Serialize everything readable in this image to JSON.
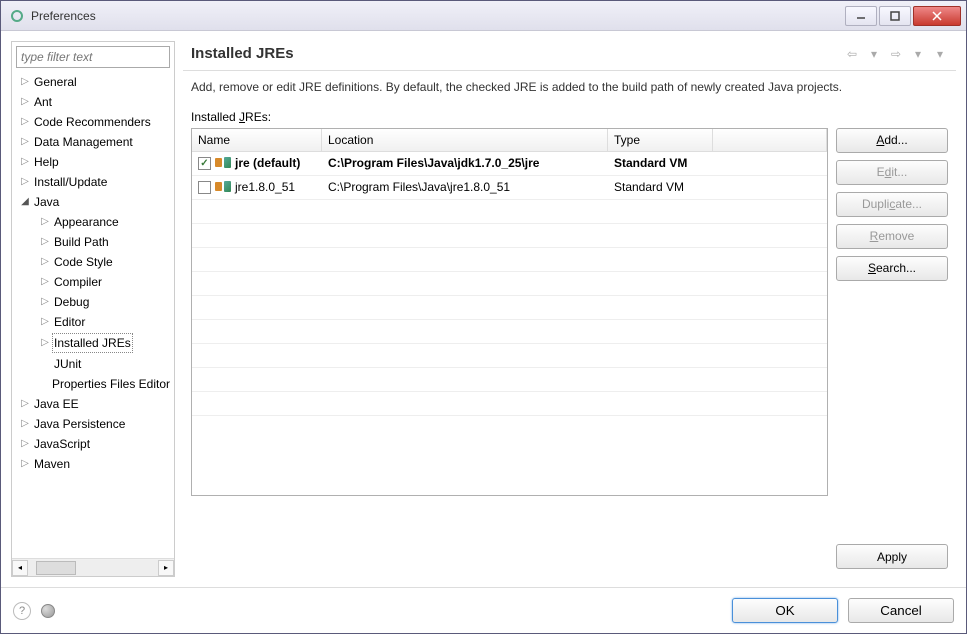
{
  "window": {
    "title": "Preferences"
  },
  "filter_placeholder": "type filter text",
  "tree": {
    "items": [
      {
        "label": "General",
        "level": 1,
        "expandable": true,
        "expanded": false
      },
      {
        "label": "Ant",
        "level": 1,
        "expandable": true,
        "expanded": false
      },
      {
        "label": "Code Recommenders",
        "level": 1,
        "expandable": true,
        "expanded": false
      },
      {
        "label": "Data Management",
        "level": 1,
        "expandable": true,
        "expanded": false
      },
      {
        "label": "Help",
        "level": 1,
        "expandable": true,
        "expanded": false
      },
      {
        "label": "Install/Update",
        "level": 1,
        "expandable": true,
        "expanded": false
      },
      {
        "label": "Java",
        "level": 1,
        "expandable": true,
        "expanded": true
      },
      {
        "label": "Appearance",
        "level": 2,
        "expandable": true,
        "expanded": false
      },
      {
        "label": "Build Path",
        "level": 2,
        "expandable": true,
        "expanded": false
      },
      {
        "label": "Code Style",
        "level": 2,
        "expandable": true,
        "expanded": false
      },
      {
        "label": "Compiler",
        "level": 2,
        "expandable": true,
        "expanded": false
      },
      {
        "label": "Debug",
        "level": 2,
        "expandable": true,
        "expanded": false
      },
      {
        "label": "Editor",
        "level": 2,
        "expandable": true,
        "expanded": false
      },
      {
        "label": "Installed JREs",
        "level": 2,
        "expandable": true,
        "expanded": false,
        "selected": true
      },
      {
        "label": "JUnit",
        "level": 2,
        "expandable": false,
        "expanded": false
      },
      {
        "label": "Properties Files Editor",
        "level": 2,
        "expandable": false,
        "expanded": false
      },
      {
        "label": "Java EE",
        "level": 1,
        "expandable": true,
        "expanded": false
      },
      {
        "label": "Java Persistence",
        "level": 1,
        "expandable": true,
        "expanded": false
      },
      {
        "label": "JavaScript",
        "level": 1,
        "expandable": true,
        "expanded": false
      },
      {
        "label": "Maven",
        "level": 1,
        "expandable": true,
        "expanded": false
      }
    ]
  },
  "main": {
    "title": "Installed JREs",
    "description": "Add, remove or edit JRE definitions. By default, the checked JRE is added to the build path of newly created Java projects.",
    "table_label_pre": "Installed ",
    "table_label_u": "J",
    "table_label_post": "REs:"
  },
  "table": {
    "columns": {
      "name": "Name",
      "location": "Location",
      "type": "Type"
    },
    "rows": [
      {
        "checked": true,
        "default": true,
        "name": "jre (default)",
        "location": "C:\\Program Files\\Java\\jdk1.7.0_25\\jre",
        "type": "Standard VM"
      },
      {
        "checked": false,
        "default": false,
        "name": "jre1.8.0_51",
        "location": "C:\\Program Files\\Java\\jre1.8.0_51",
        "type": "Standard VM"
      }
    ]
  },
  "buttons": {
    "add_u": "A",
    "add_post": "dd...",
    "edit_pre": "E",
    "edit_u": "d",
    "edit_post": "it...",
    "dup_pre": "Dupli",
    "dup_u": "c",
    "dup_post": "ate...",
    "remove_u": "R",
    "remove_post": "emove",
    "search_u": "S",
    "search_post": "earch...",
    "apply": "Apply",
    "ok": "OK",
    "cancel": "Cancel"
  }
}
